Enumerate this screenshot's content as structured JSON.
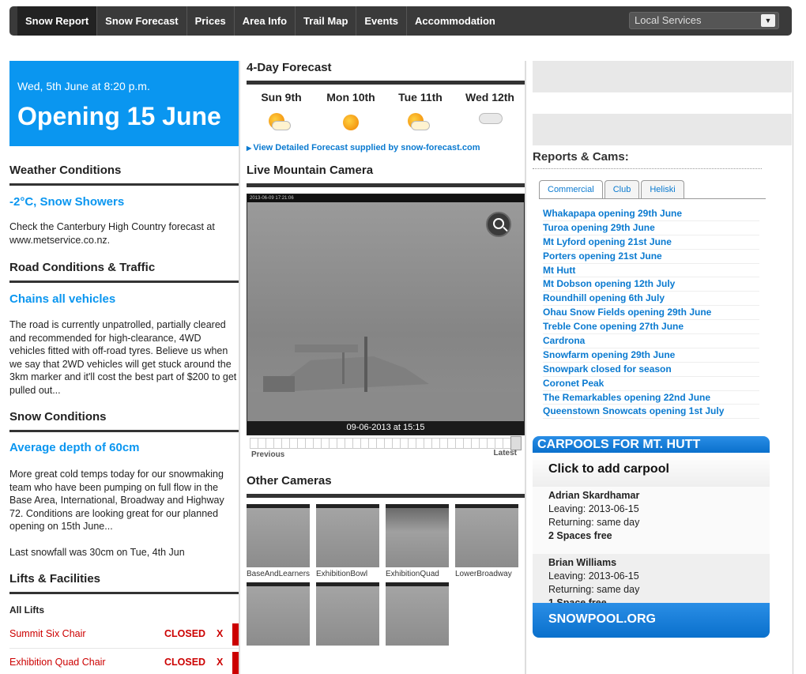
{
  "nav": {
    "items": [
      "Snow Report",
      "Snow Forecast",
      "Prices",
      "Area Info",
      "Trail Map",
      "Events",
      "Accommodation"
    ],
    "select_value": "Local Services"
  },
  "left": {
    "date": "Wed, 5th June at 8:20 p.m.",
    "opening": "Opening 15 June",
    "weather_head": "Weather Conditions",
    "weather_sub": "-2°C, Snow Showers",
    "weather_text": "Check the Canterbury High Country forecast at www.metservice.co.nz.",
    "road_head": "Road Conditions & Traffic",
    "road_sub": "Chains all vehicles",
    "road_text": "The road is currently unpatrolled, partially cleared and recommended for high-clearance, 4WD vehicles fitted with off-road tyres. Believe us when we say that 2WD vehicles will get stuck around the 3km marker and it'll cost the best part of $200 to get pulled out...",
    "snow_head": "Snow Conditions",
    "snow_sub": "Average depth of 60cm",
    "snow_text": "More great cold temps today for our snowmaking team who have been pumping on full flow in the Base Area, International, Broadway and Highway 72. Conditions are looking great for our planned opening on 15th June...",
    "last_snowfall": "Last snowfall was 30cm on Tue, 4th Jun",
    "lifts_head": "Lifts & Facilities",
    "lifts_filter": "All Lifts",
    "lifts": [
      {
        "name": "Summit Six Chair",
        "status": "CLOSED",
        "x": "X"
      },
      {
        "name": "Exhibition Quad Chair",
        "status": "CLOSED",
        "x": "X"
      }
    ]
  },
  "mid": {
    "forecast_head": "4-Day Forecast",
    "days": [
      {
        "name": "Sun 9th",
        "icon": "sun-cloud-icon"
      },
      {
        "name": "Mon 10th",
        "icon": "sun-icon"
      },
      {
        "name": "Tue 11th",
        "icon": "sun-cloud-icon"
      },
      {
        "name": "Wed 12th",
        "icon": "cloud-icon"
      }
    ],
    "forecast_link": "View Detailed Forecast supplied by snow-forecast.com",
    "camera_head": "Live Mountain Camera",
    "cam_timestamp": "2013-06-09 17:21:06",
    "cam_caption": "09-06-2013 at 15:15",
    "slider_prev": "Previous",
    "slider_latest": "Latest",
    "other_head": "Other Cameras",
    "thumbs": [
      "BaseAndLearners",
      "ExhibitionBowl",
      "ExhibitionQuad",
      "LowerBroadway",
      "",
      "",
      ""
    ]
  },
  "right": {
    "reports_head": "Reports & Cams:",
    "tabs": [
      "Commercial",
      "Club",
      "Heliski"
    ],
    "resorts": [
      "Whakapapa opening 29th June",
      "Turoa opening 29th June",
      "Mt Lyford opening 21st June",
      "Porters opening 21st June",
      "Mt Hutt",
      "Mt Dobson opening 12th July",
      "Roundhill opening 6th July",
      "Ohau Snow Fields opening 29th June",
      "Treble Cone opening 27th June",
      "Cardrona",
      "Snowfarm opening 29th June",
      "Snowpark closed for season",
      "Coronet Peak",
      "The Remarkables opening 22nd June",
      "Queenstown Snowcats opening 1st July"
    ],
    "carpool_head": "CARPOOLS FOR MT. HUTT",
    "carpool_add": "Click to add carpool",
    "carpools": [
      {
        "name": "Adrian Skardhamar",
        "leaving": "Leaving: 2013-06-15",
        "returning": "Returning: same day",
        "spaces": "2 Spaces free"
      },
      {
        "name": "Brian Williams",
        "leaving": "Leaving: 2013-06-15",
        "returning": "Returning: same day",
        "spaces": "1 Space free"
      }
    ],
    "carpool_foot": "SNOWPOOL.ORG"
  },
  "colors": {
    "accent": "#0a96f0",
    "link": "#0a7ad0",
    "closed": "#cc0000",
    "nav": "#3a3a3a"
  }
}
